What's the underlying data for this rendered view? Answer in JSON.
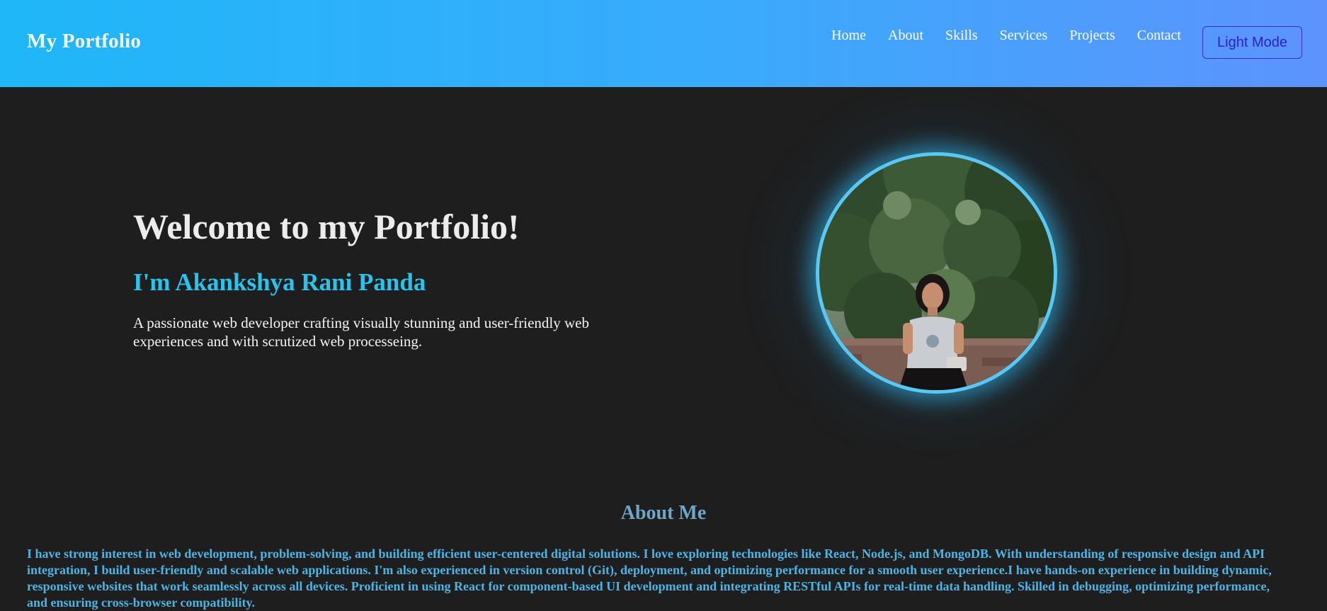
{
  "header": {
    "brand": "My Portfolio",
    "nav": [
      "Home",
      "About",
      "Skills",
      "Services",
      "Projects",
      "Contact"
    ],
    "mode_button": "Light Mode"
  },
  "hero": {
    "title": "Welcome to my Portfolio!",
    "name": "I'm Akankshya Rani Panda",
    "description": "A passionate web developer crafting visually stunning and user-friendly web experiences and with scrutized web processeing.",
    "image_alt": "profile-photo"
  },
  "about": {
    "title": "About Me",
    "text": "I have strong interest in web development, problem-solving, and building efficient user-centered digital solutions. I love exploring technologies like React, Node.js, and MongoDB. With understanding of responsive design and API integration, I build user-friendly and scalable web applications. I'm also experienced in version control (Git), deployment, and optimizing performance for a smooth user experience.I have hands-on experience in building dynamic, responsive websites that work seamlessly across all devices. Proficient in using React for component-based UI development and integrating RESTful APIs for real-time data handling. Skilled in debugging, optimizing performance, and ensuring cross-browser compatibility."
  },
  "colors": {
    "header_gradient_start": "#1fb7f8",
    "header_gradient_end": "#5d93fd",
    "background": "#1e1e1e",
    "accent_name": "#27c5ee",
    "about_title": "#6da6c8",
    "about_text": "#4fb4e3",
    "profile_border": "#5ac8f5",
    "mode_button": "#2c21c9"
  }
}
